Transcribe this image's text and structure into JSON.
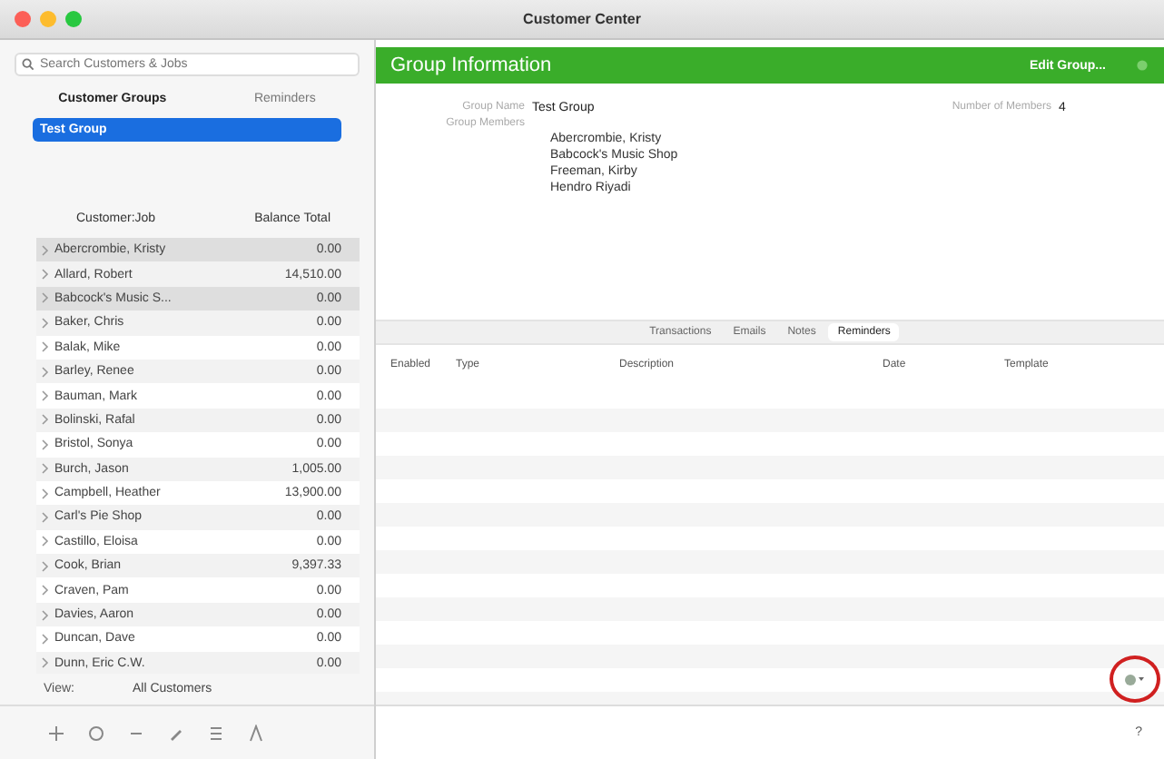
{
  "window": {
    "title": "Customer Center"
  },
  "search": {
    "placeholder": "Search Customers & Jobs"
  },
  "left_tabs": [
    {
      "label": "Customer Groups",
      "selected": true
    },
    {
      "label": "Reminders",
      "selected": false
    }
  ],
  "groups": [
    {
      "name": "Test Group",
      "selected": true
    }
  ],
  "customer_columns": [
    "Customer:Job",
    "Balance Total"
  ],
  "customers": [
    {
      "name": "Abercrombie, Kristy",
      "balance": "0.00",
      "highlighted": true
    },
    {
      "name": "Allard, Robert",
      "balance": "14,510.00",
      "highlighted": false
    },
    {
      "name": "Babcock's Music S...",
      "balance": "0.00",
      "highlighted": true
    },
    {
      "name": "Baker, Chris",
      "balance": "0.00",
      "highlighted": false
    },
    {
      "name": "Balak, Mike",
      "balance": "0.00",
      "highlighted": false
    },
    {
      "name": "Barley, Renee",
      "balance": "0.00",
      "highlighted": false
    },
    {
      "name": "Bauman, Mark",
      "balance": "0.00",
      "highlighted": false
    },
    {
      "name": "Bolinski, Rafal",
      "balance": "0.00",
      "highlighted": false
    },
    {
      "name": "Bristol, Sonya",
      "balance": "0.00",
      "highlighted": false
    },
    {
      "name": "Burch, Jason",
      "balance": "1,005.00",
      "highlighted": false
    },
    {
      "name": "Campbell, Heather",
      "balance": "13,900.00",
      "highlighted": false
    },
    {
      "name": "Carl's Pie Shop",
      "balance": "0.00",
      "highlighted": false
    },
    {
      "name": "Castillo, Eloisa",
      "balance": "0.00",
      "highlighted": false
    },
    {
      "name": "Cook, Brian",
      "balance": "9,397.33",
      "highlighted": false
    },
    {
      "name": "Craven, Pam",
      "balance": "0.00",
      "highlighted": false
    },
    {
      "name": "Davies, Aaron",
      "balance": "0.00",
      "highlighted": false
    },
    {
      "name": "Duncan, Dave",
      "balance": "0.00",
      "highlighted": false
    },
    {
      "name": "Dunn, Eric C.W.",
      "balance": "0.00",
      "highlighted": false
    }
  ],
  "view": {
    "label": "View:",
    "value": "All Customers"
  },
  "header": {
    "title": "Group Information",
    "button": "Edit Group..."
  },
  "info": {
    "name_label": "Group Name",
    "name": "Test Group",
    "members_label": "Group Members",
    "count_label": "Number of Members",
    "count": "4",
    "members": [
      "Abercrombie, Kristy",
      "Babcock's Music Shop",
      "Freeman, Kirby",
      "Hendro Riyadi"
    ]
  },
  "tabs": [
    {
      "label": "Transactions",
      "selected": false
    },
    {
      "label": "Emails",
      "selected": false
    },
    {
      "label": "Notes",
      "selected": false
    },
    {
      "label": "Reminders",
      "selected": true
    }
  ],
  "columns": [
    "Enabled",
    "Type",
    "Description",
    "Date",
    "Template"
  ],
  "help": "?"
}
